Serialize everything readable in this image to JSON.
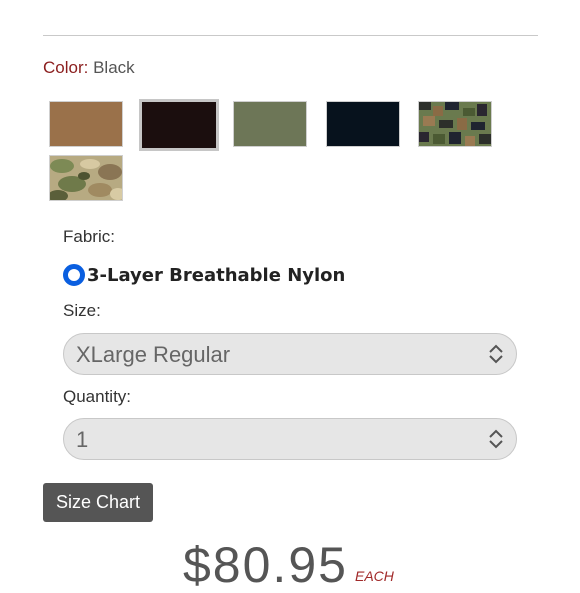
{
  "color": {
    "label": "Color:",
    "value": "Black"
  },
  "swatches": [
    {
      "name": "coyote",
      "color": "#9a714a",
      "selected": false
    },
    {
      "name": "black",
      "color": "#1b0e0e",
      "selected": true
    },
    {
      "name": "ranger-green",
      "color": "#6d7657",
      "selected": false
    },
    {
      "name": "navy",
      "color": "#07121d",
      "selected": false
    },
    {
      "name": "woodland-digital",
      "color": "#5e6e46",
      "selected": false
    },
    {
      "name": "multicam",
      "color": "#a89a6e",
      "selected": false
    }
  ],
  "fabric": {
    "label": "Fabric:",
    "option": "3-Layer Breathable Nylon",
    "selected": true
  },
  "size": {
    "label": "Size:",
    "value": "XLarge Regular"
  },
  "quantity": {
    "label": "Quantity:",
    "value": "1"
  },
  "size_chart_button": "Size Chart",
  "price": {
    "amount": "$80.95",
    "unit": "EACH"
  },
  "colors": {
    "accent_red": "#8b1e1e",
    "radio_blue": "#0a5fe0",
    "button_gray": "#555555"
  }
}
